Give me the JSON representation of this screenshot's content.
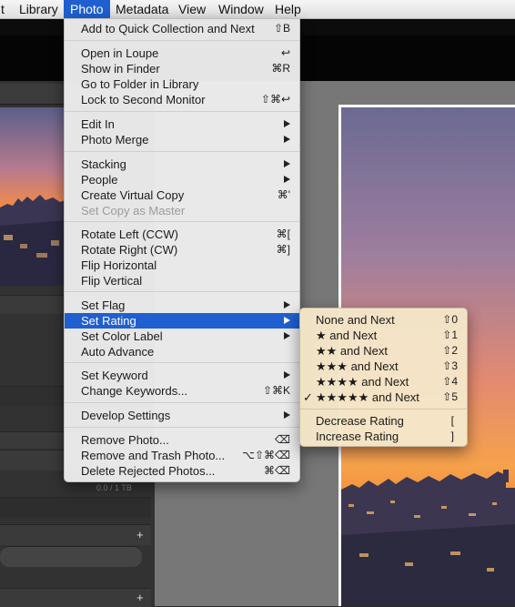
{
  "menubar": {
    "items": [
      "t",
      "Library",
      "Photo",
      "Metadata",
      "View",
      "Window",
      "Help"
    ],
    "active": "Photo"
  },
  "left_panel": {
    "volume_size": "0.0 / 1 TB"
  },
  "photo_menu": {
    "add_to_quick_collection": {
      "label": "Add to Quick Collection and Next",
      "shortcut": "⇧B"
    },
    "open_in_loupe": {
      "label": "Open in Loupe",
      "shortcut": "↩"
    },
    "show_in_finder": {
      "label": "Show in Finder",
      "shortcut": "⌘R"
    },
    "go_to_folder": {
      "label": "Go to Folder in Library"
    },
    "lock_second_monitor": {
      "label": "Lock to Second Monitor",
      "shortcut": "⇧⌘↩"
    },
    "edit_in": {
      "label": "Edit In"
    },
    "photo_merge": {
      "label": "Photo Merge"
    },
    "stacking": {
      "label": "Stacking"
    },
    "people": {
      "label": "People"
    },
    "create_virtual_copy": {
      "label": "Create Virtual Copy",
      "shortcut": "⌘'"
    },
    "set_copy_as_master": {
      "label": "Set Copy as Master",
      "disabled": true
    },
    "rotate_left": {
      "label": "Rotate Left (CCW)",
      "shortcut": "⌘["
    },
    "rotate_right": {
      "label": "Rotate Right (CW)",
      "shortcut": "⌘]"
    },
    "flip_horizontal": {
      "label": "Flip Horizontal"
    },
    "flip_vertical": {
      "label": "Flip Vertical"
    },
    "set_flag": {
      "label": "Set Flag"
    },
    "set_rating": {
      "label": "Set Rating",
      "highlighted": true
    },
    "set_color_label": {
      "label": "Set Color Label"
    },
    "auto_advance": {
      "label": "Auto Advance"
    },
    "set_keyword": {
      "label": "Set Keyword"
    },
    "change_keywords": {
      "label": "Change Keywords...",
      "shortcut": "⇧⌘K"
    },
    "develop_settings": {
      "label": "Develop Settings"
    },
    "remove_photo": {
      "label": "Remove Photo...",
      "shortcut": "⌫"
    },
    "remove_and_trash": {
      "label": "Remove and Trash Photo...",
      "shortcut": "⌥⇧⌘⌫"
    },
    "delete_rejected": {
      "label": "Delete Rejected Photos...",
      "shortcut": "⌘⌫"
    }
  },
  "rating_submenu": {
    "none_and_next": {
      "label": "None and Next",
      "shortcut": "⇧0"
    },
    "one_star": {
      "label": "★ and Next",
      "shortcut": "⇧1"
    },
    "two_stars": {
      "label": "★★ and Next",
      "shortcut": "⇧2"
    },
    "three_stars": {
      "label": "★★★ and Next",
      "shortcut": "⇧3"
    },
    "four_stars": {
      "label": "★★★★ and Next",
      "shortcut": "⇧4"
    },
    "five_stars": {
      "label": "★★★★★ and Next",
      "shortcut": "⇧5",
      "checked": true,
      "check": "✓"
    },
    "decrease_rating": {
      "label": "Decrease Rating",
      "shortcut": "["
    },
    "increase_rating": {
      "label": "Increase Rating",
      "shortcut": "]"
    }
  },
  "colors": {
    "highlight": "#1f5fd0",
    "menu_bg": "#ececec",
    "submenu_bg": "#f5e6c8"
  }
}
